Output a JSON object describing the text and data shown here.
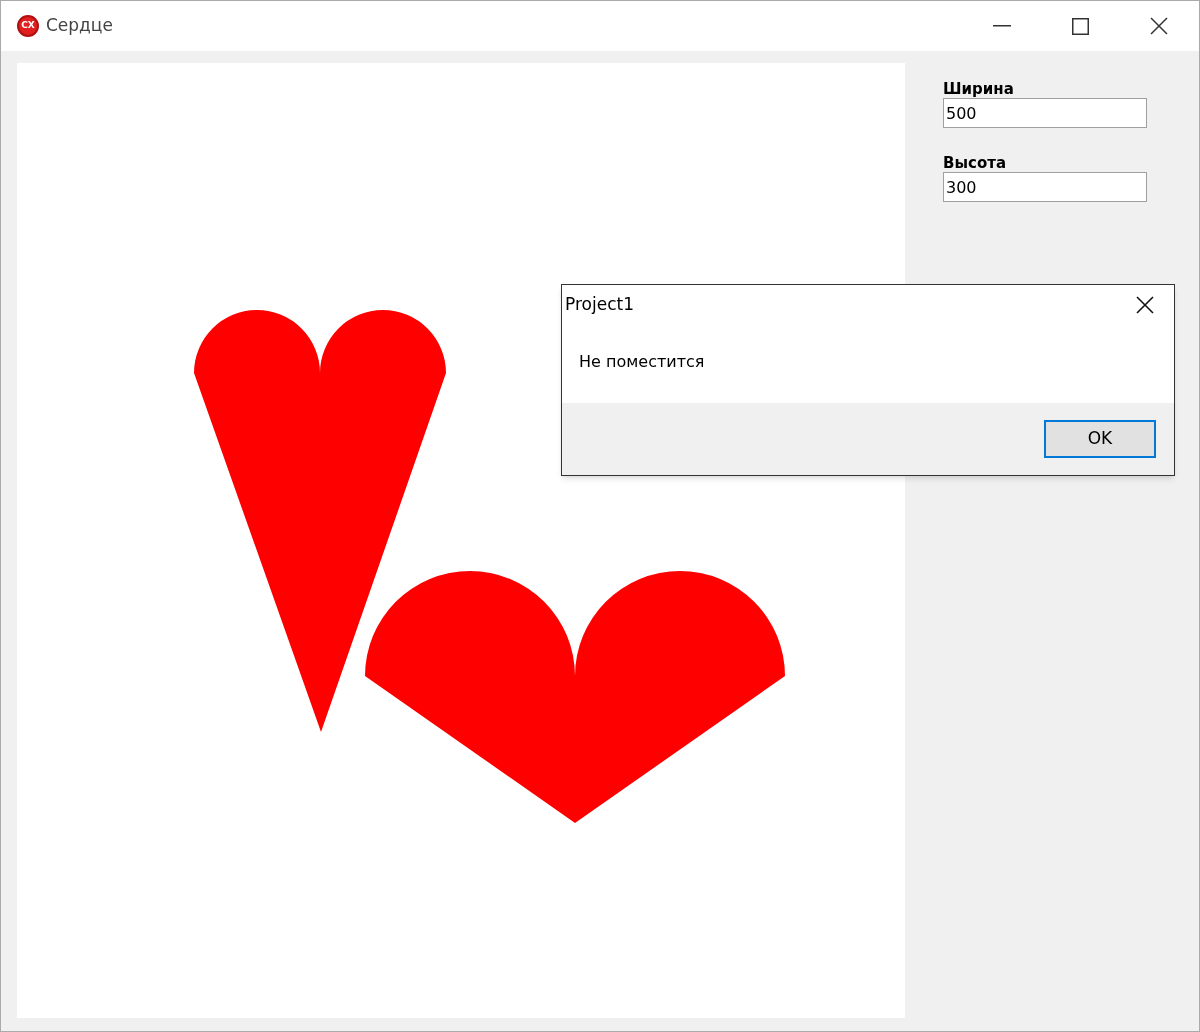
{
  "window": {
    "title": "Сердце",
    "logo_text": "CX"
  },
  "fields": [
    {
      "label": "Ширина",
      "value": "500"
    },
    {
      "label": "Высота",
      "value": "300"
    }
  ],
  "dialog": {
    "title": "Project1",
    "message": "Не поместится",
    "button": "OK"
  }
}
